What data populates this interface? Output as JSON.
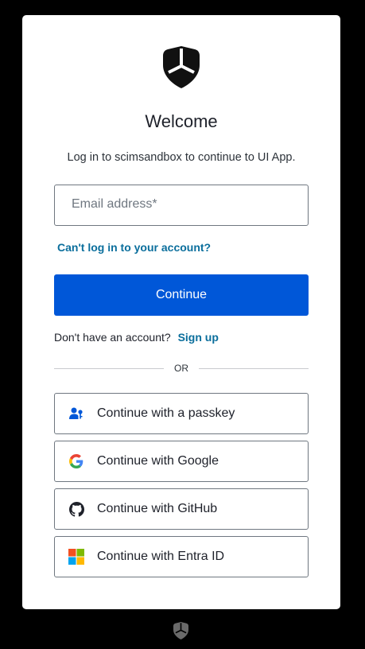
{
  "login": {
    "title": "Welcome",
    "subtitle": "Log in to scimsandbox to continue to UI App.",
    "email_placeholder": "Email address*",
    "email_value": "",
    "forgot_link": "Can't log in to your account?",
    "continue_label": "Continue",
    "signup_prompt": "Don't have an account?",
    "signup_link": "Sign up",
    "divider_text": "OR"
  },
  "social": [
    {
      "label": "Continue with a passkey",
      "icon": "passkey-icon"
    },
    {
      "label": "Continue with Google",
      "icon": "google-icon"
    },
    {
      "label": "Continue with GitHub",
      "icon": "github-icon"
    },
    {
      "label": "Continue with Entra ID",
      "icon": "microsoft-icon"
    }
  ],
  "colors": {
    "background": "#000000",
    "card": "#ffffff",
    "primary": "#0057d8",
    "link": "#0a6e9c",
    "border": "#6f7780"
  }
}
